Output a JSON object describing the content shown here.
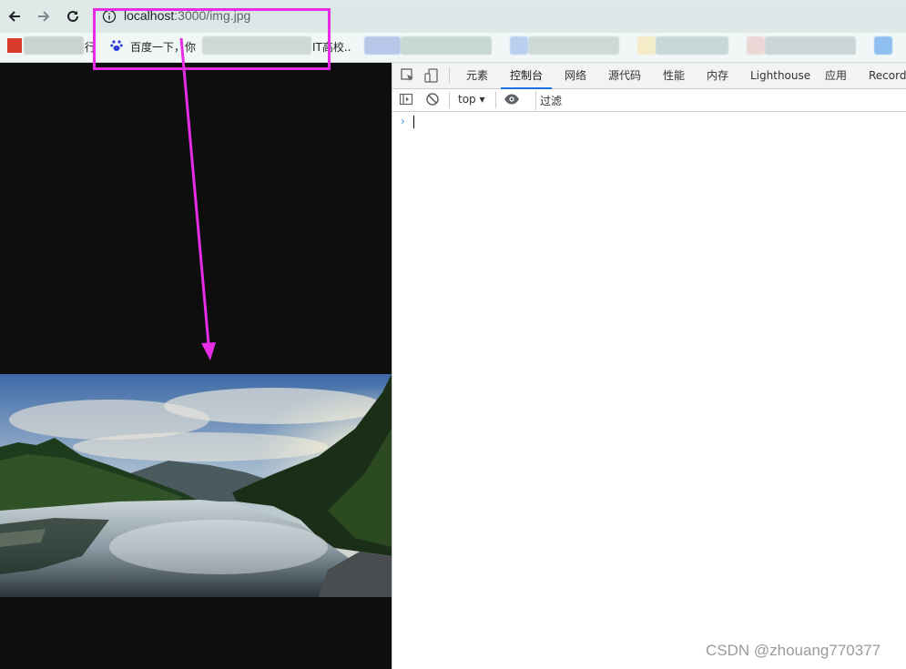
{
  "browser": {
    "url_host": "localhost",
    "url_path": ":3000/img.jpg",
    "bookmarks": [
      {
        "label": "行"
      },
      {
        "label": "百度一下，你"
      },
      {
        "label": "IT高校.."
      }
    ]
  },
  "devtools": {
    "tabs": [
      {
        "label": "元素"
      },
      {
        "label": "控制台",
        "active": true
      },
      {
        "label": "网络"
      },
      {
        "label": "源代码"
      },
      {
        "label": "性能"
      },
      {
        "label": "内存"
      },
      {
        "label": "Lighthouse"
      },
      {
        "label": "应用"
      },
      {
        "label": "Recorder"
      }
    ],
    "context": "top",
    "filter_placeholder": "过滤"
  },
  "watermark": "CSDN @zhouang770377",
  "colors": {
    "highlight": "#e62ce6",
    "active_tab": "#1a73e8",
    "viewport_bg": "#0e0e0e"
  }
}
